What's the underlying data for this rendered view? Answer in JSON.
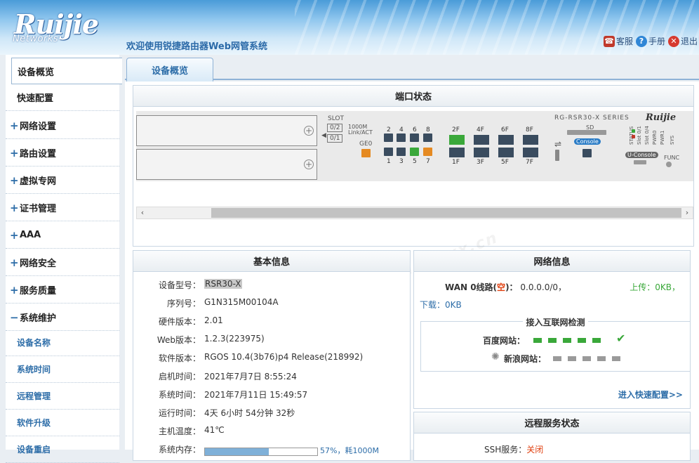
{
  "header": {
    "logo_text": "Ruijie",
    "logo_sub": "Networks",
    "welcome": "欢迎使用锐捷路由器Web网管系统",
    "links": [
      {
        "label": "客服",
        "icon": "customer-service-icon"
      },
      {
        "label": "手册",
        "icon": "help-icon"
      },
      {
        "label": "退出",
        "icon": "exit-icon"
      }
    ]
  },
  "sidebar": {
    "items": [
      {
        "label": "设备概览",
        "active": true
      },
      {
        "label": "快速配置"
      },
      {
        "label": "网络设置",
        "prefix": "+"
      },
      {
        "label": "路由设置",
        "prefix": "+"
      },
      {
        "label": "虚拟专网",
        "prefix": "+"
      },
      {
        "label": "证书管理",
        "prefix": "+"
      },
      {
        "label": "AAA",
        "prefix": "+"
      },
      {
        "label": "网络安全",
        "prefix": "+"
      },
      {
        "label": "服务质量",
        "prefix": "+"
      },
      {
        "label": "系统维护",
        "prefix": "−"
      }
    ],
    "subitems": [
      "设备名称",
      "系统时间",
      "远程管理",
      "软件升级",
      "设备重启"
    ]
  },
  "main": {
    "tab": "设备概览",
    "port_panel": {
      "title": "端口状态",
      "slot_label": "SLOT",
      "slot_btns": [
        "0/2",
        "0/1"
      ],
      "legend_1000m": "1000M",
      "legend_link": "Link/ACT",
      "ge0": "GE0",
      "model": "RG-RSR30-X SERIES",
      "brand": "Ruijie",
      "sd": "SD",
      "console": "Console",
      "uconsole": "U-Console",
      "func": "FUNC",
      "status_labels": [
        "STATUS",
        "Slot 0/1",
        "Slot 0/4",
        "PWR0",
        "PWR1",
        "SYS"
      ],
      "top_ports": [
        "2",
        "4",
        "6",
        "8"
      ],
      "bottom_ports": [
        "1",
        "3",
        "5",
        "7"
      ],
      "top_sfp": [
        "2F",
        "4F",
        "6F",
        "8F"
      ],
      "bottom_sfp": [
        "1F",
        "3F",
        "5F",
        "7F"
      ]
    },
    "basic_info": {
      "title": "基本信息",
      "rows": [
        {
          "k": "设备型号：",
          "v": "RSR30-X"
        },
        {
          "k": "序列号：",
          "v": "G1N315M00104A"
        },
        {
          "k": "硬件版本：",
          "v": "2.01"
        },
        {
          "k": "Web版本：",
          "v": "1.2.3(223975)"
        },
        {
          "k": "软件版本：",
          "v": "RGOS 10.4(3b76)p4 Release(218992)"
        },
        {
          "k": "启机时间：",
          "v": "2021年7月7日 8:55:24"
        },
        {
          "k": "系统时间：",
          "v": "2021年7月11日 15:49:57"
        },
        {
          "k": "运行时间：",
          "v": "4天 6小时 54分钟 32秒"
        },
        {
          "k": "主机温度：",
          "v": "41℃"
        }
      ],
      "mem_label": "系统内存：",
      "mem_percent": 57,
      "mem_text": "57%，耗1000M"
    },
    "net_info": {
      "title": "网络信息",
      "wan_label": "WAN 0线路(",
      "wan_state": "空",
      "wan_tail": ")：",
      "wan_ip": "0.0.0.0/0，",
      "upload": "上传：0KB，",
      "download": "下载：0KB",
      "detect_title": "接入互联网检测",
      "baidu": "百度网站：",
      "sina": "新浪网站：",
      "quick_link": "进入快速配置>>"
    },
    "remote": {
      "title": "远程服务状态",
      "ssh_label": "SSH服务：",
      "ssh_state": "关闭"
    },
    "colors": {
      "accent": "#2d6da8",
      "ok": "#3aa83a",
      "warn": "#e04010"
    }
  }
}
